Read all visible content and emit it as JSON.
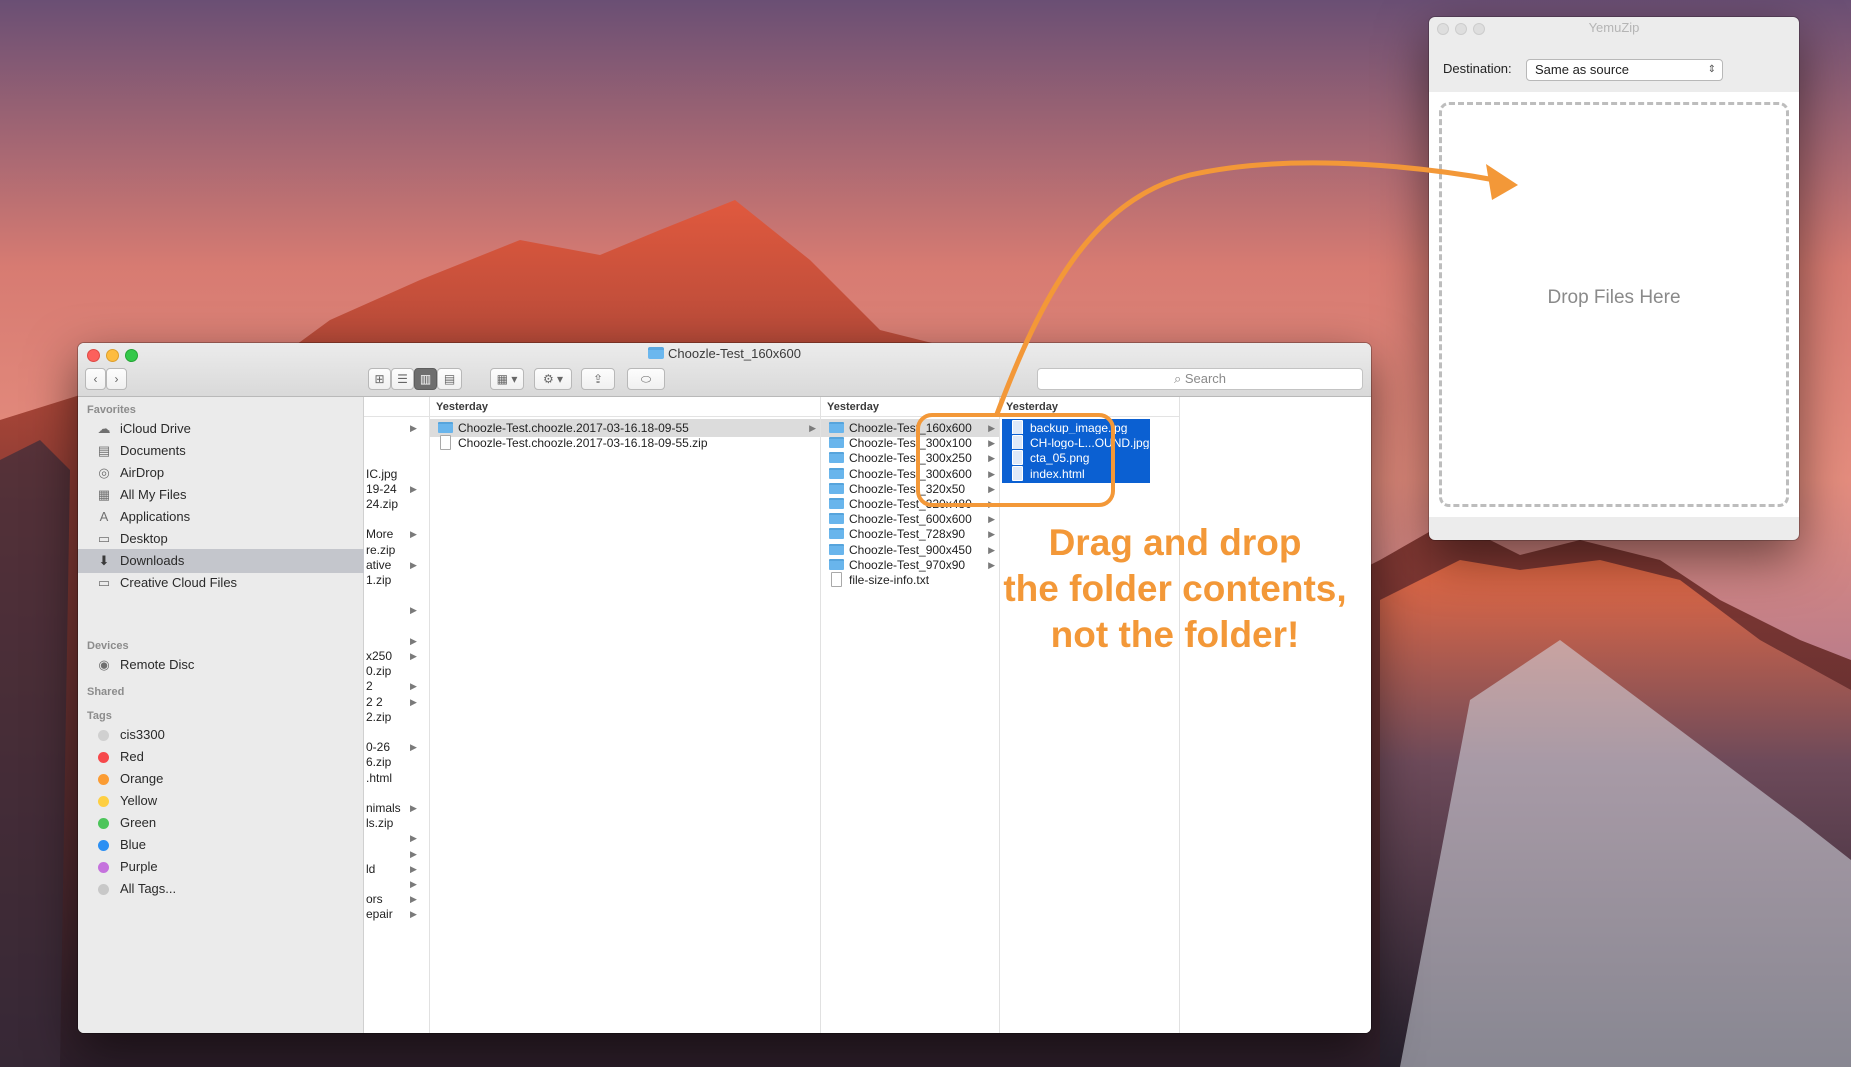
{
  "finder": {
    "title": "Choozle-Test_160x600",
    "search_placeholder": "Search",
    "sidebar": {
      "sections": {
        "favorites": "Favorites",
        "devices": "Devices",
        "shared": "Shared",
        "tags": "Tags"
      },
      "favorites": [
        {
          "label": "iCloud Drive",
          "icon": "cloud-icon"
        },
        {
          "label": "Documents",
          "icon": "documents-icon"
        },
        {
          "label": "AirDrop",
          "icon": "airdrop-icon"
        },
        {
          "label": "All My Files",
          "icon": "all-files-icon"
        },
        {
          "label": "Applications",
          "icon": "applications-icon"
        },
        {
          "label": "Desktop",
          "icon": "desktop-icon"
        },
        {
          "label": "Downloads",
          "icon": "downloads-icon",
          "selected": true
        },
        {
          "label": "Creative Cloud Files",
          "icon": "folder-icon"
        }
      ],
      "devices": [
        {
          "label": "Remote Disc",
          "icon": "disc-icon"
        }
      ],
      "tags": [
        {
          "label": "cis3300",
          "color": "#d0d0d0"
        },
        {
          "label": "Red",
          "color": "#f6484b"
        },
        {
          "label": "Orange",
          "color": "#fb9c33"
        },
        {
          "label": "Yellow",
          "color": "#fecf42"
        },
        {
          "label": "Green",
          "color": "#4cc55a"
        },
        {
          "label": "Blue",
          "color": "#2b8ff3"
        },
        {
          "label": "Purple",
          "color": "#c572dd"
        },
        {
          "label": "All Tags...",
          "color": "#c8c8c8"
        }
      ]
    },
    "partial_column": {
      "rows": [
        {
          "text": "",
          "chev": true
        },
        {
          "text": "",
          "chev": false
        },
        {
          "text": "",
          "chev": false
        },
        {
          "text": "IC.jpg",
          "chev": false
        },
        {
          "text": "19-24",
          "chev": true
        },
        {
          "text": "24.zip",
          "chev": false
        },
        {
          "text": "",
          "chev": false
        },
        {
          "text": "More",
          "chev": true
        },
        {
          "text": "re.zip",
          "chev": false
        },
        {
          "text": "ative",
          "chev": true
        },
        {
          "text": "1.zip",
          "chev": false
        },
        {
          "text": "",
          "chev": false
        },
        {
          "text": "",
          "chev": true
        },
        {
          "text": "",
          "chev": false
        },
        {
          "text": "",
          "chev": true
        },
        {
          "text": "x250",
          "chev": true
        },
        {
          "text": "0.zip",
          "chev": false
        },
        {
          "text": "2",
          "chev": true
        },
        {
          "text": "2 2",
          "chev": true
        },
        {
          "text": "2.zip",
          "chev": false
        },
        {
          "text": "",
          "chev": false
        },
        {
          "text": "0-26",
          "chev": true
        },
        {
          "text": "6.zip",
          "chev": false
        },
        {
          "text": ".html",
          "chev": false
        },
        {
          "text": "",
          "chev": false
        },
        {
          "text": "nimals",
          "chev": true
        },
        {
          "text": "ls.zip",
          "chev": false
        },
        {
          "text": "",
          "chev": true
        },
        {
          "text": "",
          "chev": true
        },
        {
          "text": "ld",
          "chev": true
        },
        {
          "text": "",
          "chev": true
        },
        {
          "text": "ors",
          "chev": true
        },
        {
          "text": "epair",
          "chev": true
        }
      ]
    },
    "column1": {
      "header": "Yesterday",
      "rows": [
        {
          "label": "Choozle-Test.choozle.2017-03-16.18-09-55",
          "type": "folder",
          "chev": true,
          "highlight": true
        },
        {
          "label": "Choozle-Test.choozle.2017-03-16.18-09-55.zip",
          "type": "file",
          "chev": false
        }
      ]
    },
    "column2": {
      "header": "Yesterday",
      "rows": [
        {
          "label": "Choozle-Test_160x600",
          "type": "folder",
          "chev": true,
          "highlight": true
        },
        {
          "label": "Choozle-Test_300x100",
          "type": "folder",
          "chev": true
        },
        {
          "label": "Choozle-Test_300x250",
          "type": "folder",
          "chev": true
        },
        {
          "label": "Choozle-Test_300x600",
          "type": "folder",
          "chev": true
        },
        {
          "label": "Choozle-Test_320x50",
          "type": "folder",
          "chev": true
        },
        {
          "label": "Choozle-Test_320x480",
          "type": "folder",
          "chev": true
        },
        {
          "label": "Choozle-Test_600x600",
          "type": "folder",
          "chev": true
        },
        {
          "label": "Choozle-Test_728x90",
          "type": "folder",
          "chev": true
        },
        {
          "label": "Choozle-Test_900x450",
          "type": "folder",
          "chev": true
        },
        {
          "label": "Choozle-Test_970x90",
          "type": "folder",
          "chev": true
        },
        {
          "label": "file-size-info.txt",
          "type": "file",
          "chev": false
        }
      ]
    },
    "column3": {
      "header": "Yesterday",
      "rows": [
        {
          "label": "backup_image.jpg",
          "type": "file",
          "selected": true
        },
        {
          "label": "CH-logo-L...OUND.jpg",
          "type": "file",
          "selected": true
        },
        {
          "label": "cta_05.png",
          "type": "file",
          "selected": true
        },
        {
          "label": "index.html",
          "type": "file",
          "selected": true
        }
      ]
    }
  },
  "yemuzip": {
    "title": "YemuZip",
    "destination_label": "Destination:",
    "destination_value": "Same as source",
    "drop_text": "Drop Files Here"
  },
  "annotation": {
    "lines": [
      "Drag and drop",
      "the folder contents,",
      "not the folder!"
    ],
    "color": "#f39838"
  }
}
